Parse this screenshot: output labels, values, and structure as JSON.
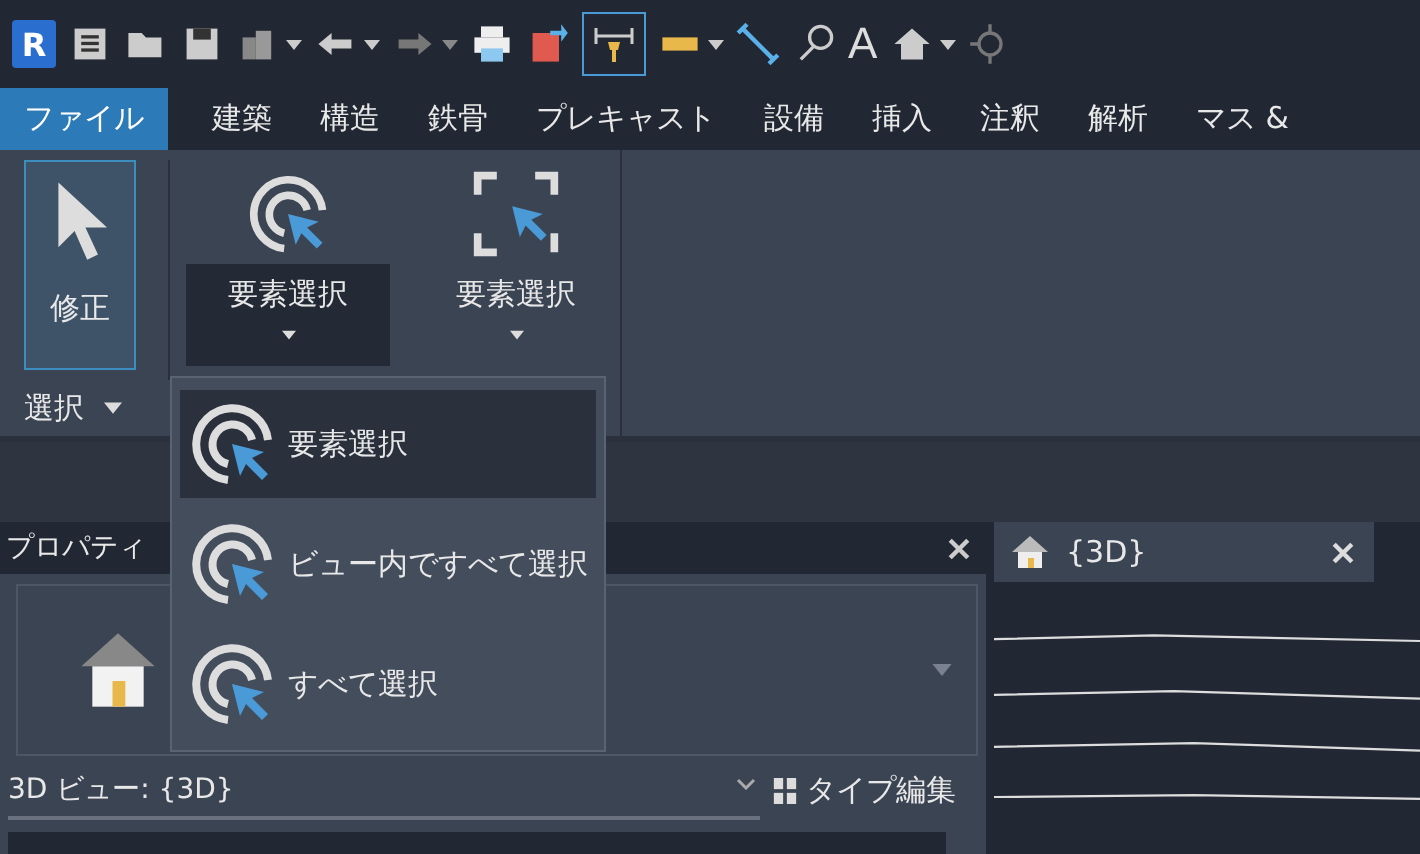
{
  "app_logo": "R",
  "text_tool": "A",
  "ribbon_tabs": [
    {
      "label": "ファイル",
      "selected": true
    },
    {
      "label": "建築",
      "selected": false
    },
    {
      "label": "構造",
      "selected": false
    },
    {
      "label": "鉄骨",
      "selected": false
    },
    {
      "label": "プレキャスト",
      "selected": false
    },
    {
      "label": "設備",
      "selected": false
    },
    {
      "label": "挿入",
      "selected": false
    },
    {
      "label": "注釈",
      "selected": false
    },
    {
      "label": "解析",
      "selected": false
    },
    {
      "label": "マス &",
      "selected": false
    }
  ],
  "ribbon": {
    "modify_button": {
      "label": "修正",
      "selected": true
    },
    "select_buttons": [
      {
        "label": "要素選択",
        "pressed": true,
        "kind": "rings"
      },
      {
        "label": "要素選択",
        "pressed": false,
        "kind": "frame"
      }
    ],
    "panel_label": "選択"
  },
  "dropdown_menu": [
    {
      "label": "要素選択",
      "selected": true
    },
    {
      "label": "ビュー内ですべて選択",
      "selected": false
    },
    {
      "label": "すべて選択",
      "selected": false
    }
  ],
  "properties": {
    "title": "プロパティ",
    "view_selector": "3D ビュー: {3D}",
    "edit_type_button": "タイプ編集"
  },
  "view_tab": {
    "title": "{3D}"
  }
}
